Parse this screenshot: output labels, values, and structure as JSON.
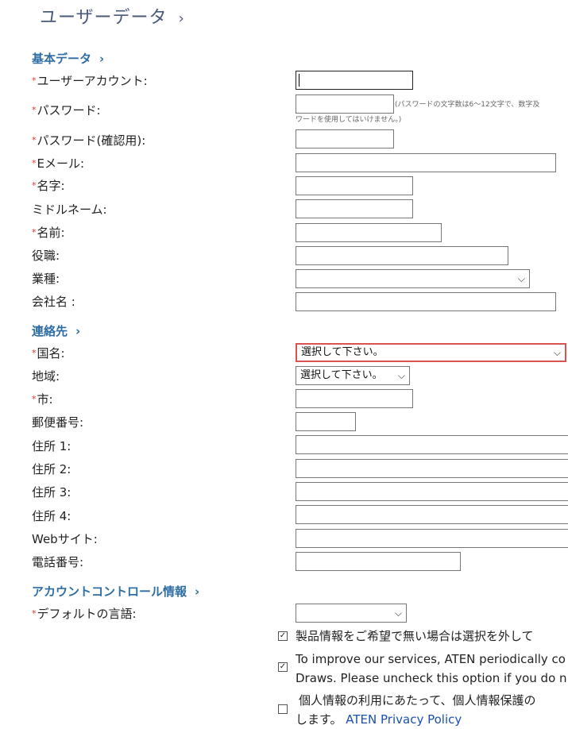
{
  "page": {
    "title": "ユーザーデータ"
  },
  "sections": {
    "basic": "基本データ",
    "contact": "連絡先",
    "account": "アカウントコントロール情報"
  },
  "fields": {
    "account": "ユーザーアカウント:",
    "password": "パスワード:",
    "password_hint_1": "(パスワードの文字数は6～12文字で、数字及",
    "password_hint_2": "ワードを使用してはいけません。)",
    "password_confirm": "パスワード(確認用):",
    "email": "Eメール:",
    "last_name": "名字:",
    "middle_name": "ミドルネーム:",
    "first_name": "名前:",
    "job_title": "役職:",
    "industry": "業種:",
    "company": "会社名 :",
    "country": "国名:",
    "country_value": "選択して下さい。",
    "region": "地域:",
    "region_value": "選択して下さい。",
    "city": "市:",
    "postal": "郵便番号:",
    "address1": "住所 1:",
    "address2": "住所 2:",
    "address3": "住所 3:",
    "address4": "住所 4:",
    "website": "Webサイト:",
    "phone": "電話番号:",
    "language": "デフォルトの言語:"
  },
  "checkboxes": {
    "product_info": {
      "text": "製品情報をご希望で無い場合は選択を外して",
      "checked": true
    },
    "improve_line1": "To improve our services, ATEN periodically co",
    "improve_line2": "Draws. Please uncheck this option if you do n",
    "improve_checked": true,
    "privacy_line1": "個人情報の利用にあたって、個人情報保護の",
    "privacy_line2": "します。",
    "privacy_link": "ATEN Privacy Policy",
    "privacy_checked": false
  },
  "glyphs": {
    "required": "*",
    "chevron": "›",
    "arrow": "⌵",
    "check": "✓"
  }
}
